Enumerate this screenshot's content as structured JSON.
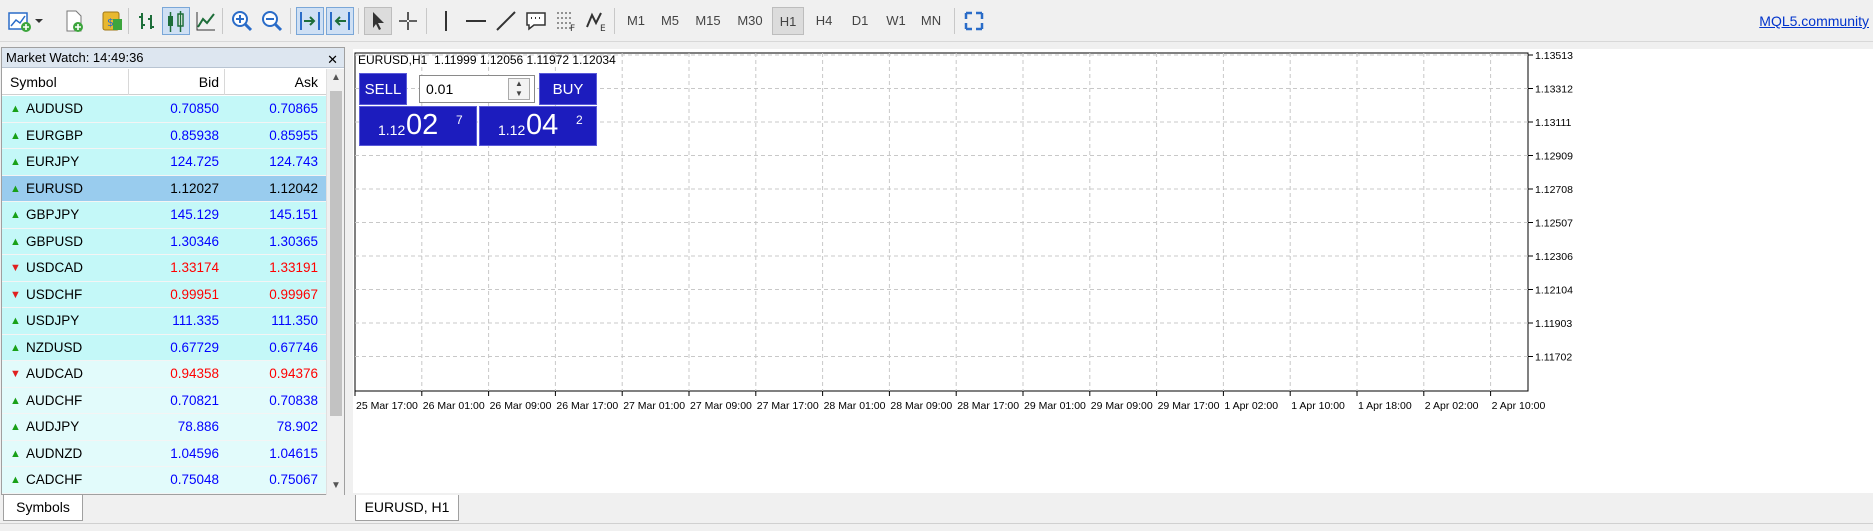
{
  "toolbar": {
    "timeframes": [
      "M1",
      "M5",
      "M15",
      "M30",
      "H1",
      "H4",
      "D1",
      "W1",
      "MN"
    ],
    "active_timeframe": "H1",
    "community_link": "MQL5.community"
  },
  "market_watch": {
    "title": "Market Watch: 14:49:36",
    "columns": {
      "symbol": "Symbol",
      "bid": "Bid",
      "ask": "Ask"
    },
    "selected": "EURUSD",
    "colors": {
      "up": "#0000ff",
      "down": "#ff0000",
      "row_bg": "#c4f8f8",
      "row_bg_light": "#e2fbfb",
      "selected_bg": "#99ccee"
    },
    "rows": [
      {
        "symbol": "AUDUSD",
        "bid": "0.70850",
        "ask": "0.70865",
        "dir": "up"
      },
      {
        "symbol": "EURGBP",
        "bid": "0.85938",
        "ask": "0.85955",
        "dir": "up"
      },
      {
        "symbol": "EURJPY",
        "bid": "124.725",
        "ask": "124.743",
        "dir": "up"
      },
      {
        "symbol": "EURUSD",
        "bid": "1.12027",
        "ask": "1.12042",
        "dir": "up"
      },
      {
        "symbol": "GBPJPY",
        "bid": "145.129",
        "ask": "145.151",
        "dir": "up"
      },
      {
        "symbol": "GBPUSD",
        "bid": "1.30346",
        "ask": "1.30365",
        "dir": "up"
      },
      {
        "symbol": "USDCAD",
        "bid": "1.33174",
        "ask": "1.33191",
        "dir": "down"
      },
      {
        "symbol": "USDCHF",
        "bid": "0.99951",
        "ask": "0.99967",
        "dir": "down"
      },
      {
        "symbol": "USDJPY",
        "bid": "111.335",
        "ask": "111.350",
        "dir": "up"
      },
      {
        "symbol": "NZDUSD",
        "bid": "0.67729",
        "ask": "0.67746",
        "dir": "up"
      },
      {
        "symbol": "AUDCAD",
        "bid": "0.94358",
        "ask": "0.94376",
        "dir": "down"
      },
      {
        "symbol": "AUDCHF",
        "bid": "0.70821",
        "ask": "0.70838",
        "dir": "up"
      },
      {
        "symbol": "AUDJPY",
        "bid": "78.886",
        "ask": "78.902",
        "dir": "up"
      },
      {
        "symbol": "AUDNZD",
        "bid": "1.04596",
        "ask": "1.04615",
        "dir": "up"
      },
      {
        "symbol": "CADCHF",
        "bid": "0.75048",
        "ask": "0.75067",
        "dir": "up"
      }
    ],
    "tab_label": "Symbols"
  },
  "chart": {
    "info": "EURUSD,H1  1.11999 1.12056 1.11972 1.12034",
    "tab_label": "EURUSD, H1",
    "one_click": {
      "sell_label": "SELL",
      "buy_label": "BUY",
      "lot": "0.01",
      "sell_price": {
        "prefix": "1.12",
        "big": "02",
        "sup": "7"
      },
      "buy_price": {
        "prefix": "1.12",
        "big": "04",
        "sup": "2"
      }
    },
    "price_axis": [
      "1.13513",
      "1.13312",
      "1.13111",
      "1.12909",
      "1.12708",
      "1.12507",
      "1.12306",
      "1.12104",
      "1.11903",
      "1.11702"
    ],
    "time_axis": [
      "25 Mar 17:00",
      "26 Mar 01:00",
      "26 Mar 09:00",
      "26 Mar 17:00",
      "27 Mar 01:00",
      "27 Mar 09:00",
      "27 Mar 17:00",
      "28 Mar 01:00",
      "28 Mar 09:00",
      "28 Mar 17:00",
      "29 Mar 01:00",
      "29 Mar 09:00",
      "29 Mar 17:00",
      "1 Apr 02:00",
      "1 Apr 10:00",
      "1 Apr 18:00",
      "2 Apr 02:00",
      "2 Apr 10:00"
    ]
  }
}
